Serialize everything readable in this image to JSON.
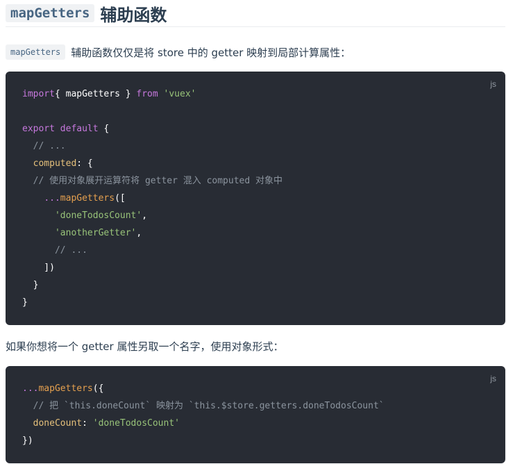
{
  "heading": {
    "code": "mapGetters",
    "title": "辅助函数"
  },
  "intro": {
    "code": "mapGetters",
    "text": "辅助函数仅仅是将 store 中的 getter 映射到局部计算属性："
  },
  "code1": {
    "lang": "js",
    "lines": [
      [
        [
          "kw",
          "import"
        ],
        [
          "",
          "{ "
        ],
        [
          "",
          "mapGetters"
        ],
        [
          "",
          " } "
        ],
        [
          "kw",
          "from"
        ],
        [
          "",
          " "
        ],
        [
          "str",
          "'vuex'"
        ]
      ],
      [],
      [
        [
          "kw",
          "export"
        ],
        [
          "",
          " "
        ],
        [
          "kw",
          "default"
        ],
        [
          "",
          " {"
        ]
      ],
      [
        [
          "",
          "  "
        ],
        [
          "cm",
          "// ..."
        ]
      ],
      [
        [
          "",
          "  "
        ],
        [
          "prop",
          "computed"
        ],
        [
          "",
          ": {"
        ]
      ],
      [
        [
          "",
          "  "
        ],
        [
          "cm",
          "// 使用对象展开运算符将 getter 混入 computed 对象中"
        ]
      ],
      [
        [
          "",
          "    "
        ],
        [
          "kw",
          "..."
        ],
        [
          "fn",
          "mapGetters"
        ],
        [
          "",
          "(["
        ]
      ],
      [
        [
          "",
          "      "
        ],
        [
          "str",
          "'doneTodosCount'"
        ],
        [
          "",
          ","
        ]
      ],
      [
        [
          "",
          "      "
        ],
        [
          "str",
          "'anotherGetter'"
        ],
        [
          "",
          ","
        ]
      ],
      [
        [
          "",
          "      "
        ],
        [
          "cm",
          "// ..."
        ]
      ],
      [
        [
          "",
          "    ])"
        ]
      ],
      [
        [
          "",
          "  }"
        ]
      ],
      [
        [
          "",
          "}"
        ]
      ]
    ]
  },
  "para2": {
    "text": "如果你想将一个 getter 属性另取一个名字，使用对象形式："
  },
  "code2": {
    "lang": "js",
    "lines": [
      [
        [
          "kw",
          "..."
        ],
        [
          "fn",
          "mapGetters"
        ],
        [
          "",
          "({"
        ]
      ],
      [
        [
          "",
          "  "
        ],
        [
          "cm",
          "// 把 `this.doneCount` 映射为 `this.$store.getters.doneTodosCount`"
        ]
      ],
      [
        [
          "",
          "  "
        ],
        [
          "prop",
          "doneCount"
        ],
        [
          "",
          ": "
        ],
        [
          "str",
          "'doneTodosCount'"
        ]
      ],
      [
        [
          "",
          "})"
        ]
      ]
    ]
  }
}
